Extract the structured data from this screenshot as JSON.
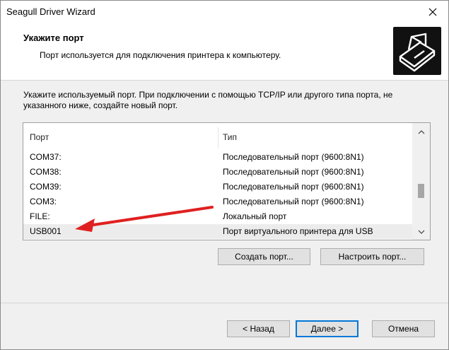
{
  "window": {
    "title": "Seagull Driver Wizard"
  },
  "header": {
    "title": "Укажите порт",
    "subtitle": "Порт используется для подключения принтера к компьютеру."
  },
  "instruction": "Укажите используемый порт. При подключении с помощью TCP/IP или другого типа порта, не указанного ниже, создайте новый порт.",
  "port_list": {
    "columns": [
      "Порт",
      "Тип"
    ],
    "rows": [
      {
        "port": "COM37:",
        "type": "Последовательный порт (9600:8N1)"
      },
      {
        "port": "COM38:",
        "type": "Последовательный порт (9600:8N1)"
      },
      {
        "port": "COM39:",
        "type": "Последовательный порт (9600:8N1)"
      },
      {
        "port": "COM3:",
        "type": "Последовательный порт (9600:8N1)"
      },
      {
        "port": "FILE:",
        "type": "Локальный порт"
      },
      {
        "port": "USB001",
        "type": "Порт виртуального принтера для USB"
      }
    ],
    "selected": "USB001"
  },
  "port_buttons": {
    "create": "Создать порт...",
    "configure": "Настроить порт..."
  },
  "footer": {
    "back": "< Назад",
    "next": "Далее >",
    "cancel": "Отмена"
  },
  "colors": {
    "annotation_arrow": "#e02020",
    "focus": "#0078d7"
  },
  "icons": {
    "close": "close-icon",
    "printer": "printer-icon",
    "scroll_up": "chevron-up-icon",
    "scroll_down": "chevron-down-icon"
  }
}
